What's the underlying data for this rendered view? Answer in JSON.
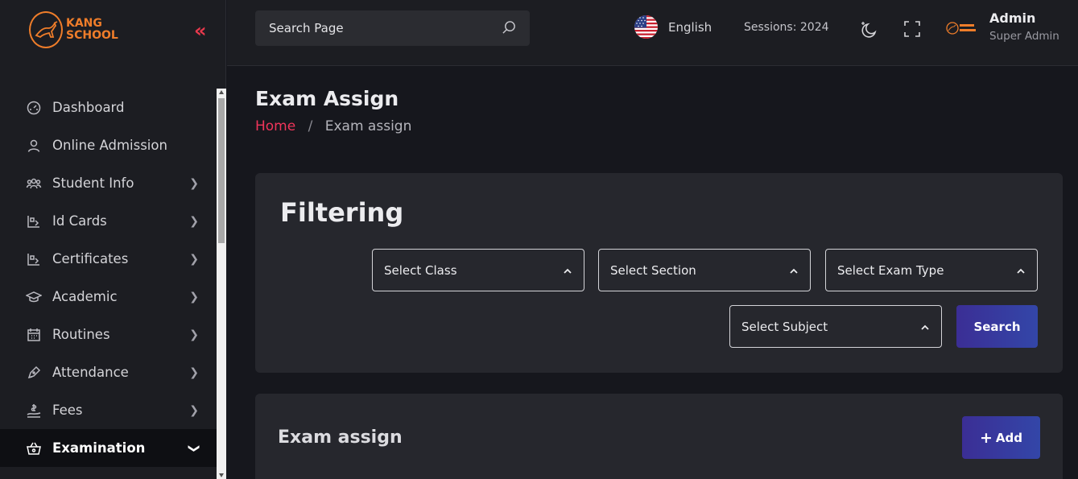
{
  "brand": {
    "name_line1": "KANG",
    "name_line2": "SCHOOL",
    "color": "#ef7d2a"
  },
  "sidebar": {
    "collapse_icon": "double-chevron-left-icon",
    "items": [
      {
        "label": "Dashboard",
        "icon": "speedometer-icon",
        "has_submenu": false
      },
      {
        "label": "Online Admission",
        "icon": "user-icon",
        "has_submenu": false
      },
      {
        "label": "Student Info",
        "icon": "users-group-icon",
        "has_submenu": true
      },
      {
        "label": "Id Cards",
        "icon": "id-card-icon",
        "has_submenu": true
      },
      {
        "label": "Certificates",
        "icon": "certificate-icon",
        "has_submenu": true
      },
      {
        "label": "Academic",
        "icon": "graduation-cap-icon",
        "has_submenu": true
      },
      {
        "label": "Routines",
        "icon": "calendar-icon",
        "has_submenu": true
      },
      {
        "label": "Attendance",
        "icon": "pen-icon",
        "has_submenu": true
      },
      {
        "label": "Fees",
        "icon": "money-hand-icon",
        "has_submenu": true
      },
      {
        "label": "Examination",
        "icon": "basket-icon",
        "has_submenu": true,
        "active": true
      }
    ]
  },
  "header": {
    "search_placeholder": "Search Page",
    "language": "English",
    "sessions": "Sessions: 2024",
    "user_name": "Admin",
    "user_role": "Super Admin"
  },
  "page": {
    "title": "Exam Assign",
    "breadcrumb_home": "Home",
    "breadcrumb_separator": "/",
    "breadcrumb_current": "Exam assign"
  },
  "filter": {
    "title": "Filtering",
    "select_class": "Select Class",
    "select_section": "Select Section",
    "select_exam_type": "Select Exam Type",
    "select_subject": "Select Subject",
    "search_label": "Search"
  },
  "list": {
    "title": "Exam assign",
    "add_label": "Add",
    "add_plus": "+"
  },
  "colors": {
    "accent": "#f0355a",
    "button_gradient_start": "#3b2e95",
    "button_gradient_end": "#3346a8",
    "background": "#16171d",
    "card": "#26272d"
  }
}
